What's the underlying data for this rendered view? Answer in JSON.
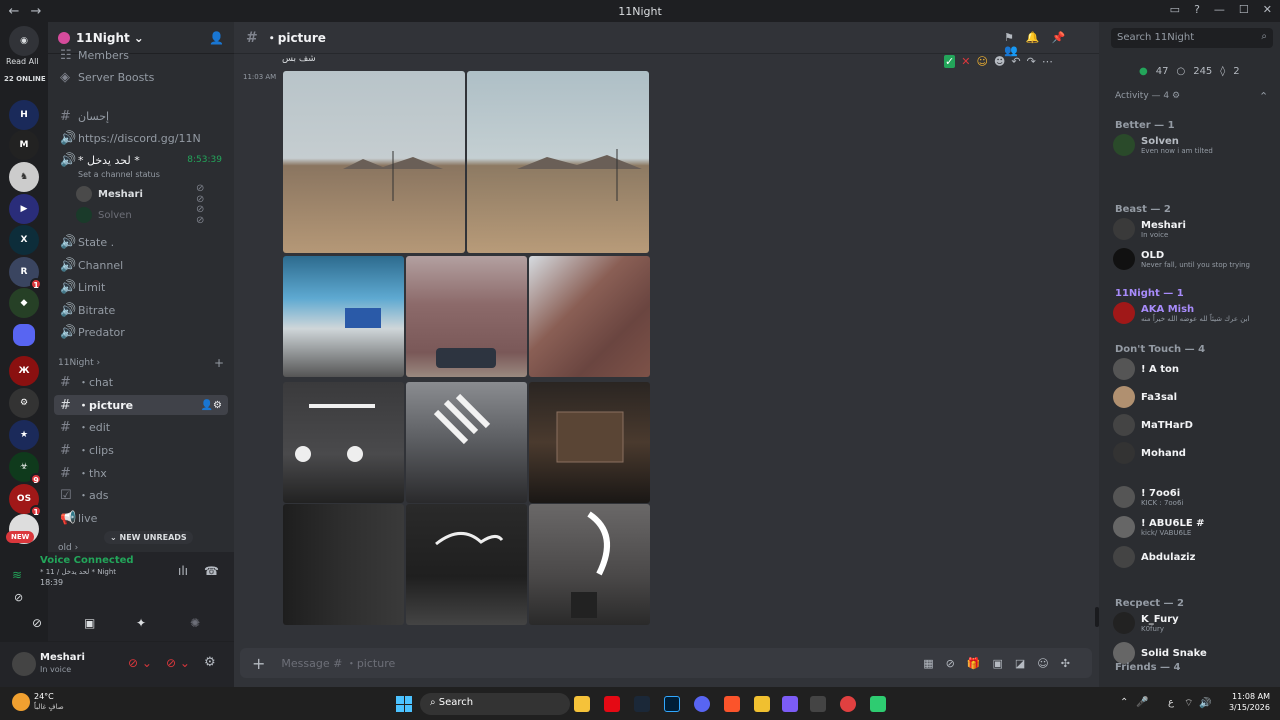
{
  "window": {
    "title": "11Night",
    "back": "←",
    "forward": "→"
  },
  "rail": {
    "read_all": "Read All",
    "online": "22 ONLINE",
    "new_label": "NEW"
  },
  "guild": {
    "name": "11Night"
  },
  "sidebar": {
    "members_partial": "Members",
    "server_boosts": "Server Boosts",
    "channels_top": [
      {
        "icon": "#",
        "name": "إحسان"
      },
      {
        "icon": "🔊",
        "name": "https://discord.gg/11N"
      }
    ],
    "voice_channel": {
      "name": "* لحد يدخل *",
      "timer": "8:53:39",
      "status": "Set a channel status",
      "users": [
        {
          "name": "Meshari"
        },
        {
          "name": "Solven"
        }
      ]
    },
    "voice_channels": [
      {
        "name": "State ."
      },
      {
        "name": "Channel"
      },
      {
        "name": "Limit"
      },
      {
        "name": "Bitrate"
      },
      {
        "name": "Predator"
      }
    ],
    "category": "11Night",
    "text_channels": [
      {
        "name": "・chat"
      },
      {
        "name": "・picture"
      },
      {
        "name": "・edit"
      },
      {
        "name": "・clips"
      },
      {
        "name": "・thx"
      },
      {
        "name": "・ads"
      },
      {
        "name": "live"
      }
    ],
    "category2": "old",
    "new_unreads": "NEW UNREADS"
  },
  "voice_panel": {
    "status": "Voice Connected",
    "channel": "* 11 / لحد يدخل * Night",
    "time": "18:39"
  },
  "user_panel": {
    "name": "Meshari",
    "status": "In voice"
  },
  "chat": {
    "channel": "・picture",
    "message_top": "شف بس",
    "timestamp": "11:03 AM",
    "composer_placeholder": "Message # ・picture"
  },
  "members": {
    "search_placeholder": "Search 11Night",
    "counts": {
      "online": "47",
      "offline": "245",
      "boost": "2"
    },
    "activity": "Activity — 4",
    "groups": [
      {
        "label": "Better — 1",
        "color": "#949ba4",
        "members": [
          {
            "name": "Solven",
            "sub": "Even now i am tilted",
            "color": "#b5bac1"
          }
        ]
      },
      {
        "label": "Beast — 2",
        "color": "#949ba4",
        "members": [
          {
            "name": "Meshari",
            "sub": "In voice",
            "color": "#f2f3f5"
          },
          {
            "name": "OLD",
            "sub": "Never fall, until you stop trying",
            "color": "#f2f3f5"
          }
        ]
      },
      {
        "label": "11Night — 1",
        "color": "#a78bfa",
        "members": [
          {
            "name": "AKA Mish",
            "sub": "ابن عرك شيئاً لله عوضه الله خيراً منه",
            "color": "#a78bfa"
          }
        ]
      },
      {
        "label": "Don't Touch — 4",
        "color": "#949ba4",
        "members": [
          {
            "name": "! A ton",
            "sub": "",
            "color": "#f2f3f5"
          },
          {
            "name": "Fa3sal",
            "sub": "",
            "color": "#f2f3f5"
          },
          {
            "name": "MaTHarD",
            "sub": "",
            "color": "#f2f3f5"
          },
          {
            "name": "Mohand",
            "sub": "",
            "color": "#f2f3f5"
          }
        ]
      },
      {
        "label": "",
        "color": "#949ba4",
        "members": [
          {
            "name": "! 7oo6i",
            "sub": "KICK : 7oo6i",
            "color": "#f2f3f5"
          },
          {
            "name": "! ABU6LE #",
            "sub": "kick/ VABU6LE",
            "color": "#f2f3f5"
          },
          {
            "name": "Abdulaziz",
            "sub": "",
            "color": "#f2f3f5"
          }
        ]
      },
      {
        "label": "Recpect — 2",
        "color": "#949ba4",
        "members": [
          {
            "name": "K_Fury",
            "sub": "K0fury",
            "color": "#f2f3f5"
          },
          {
            "name": "Solid Snake",
            "sub": "",
            "color": "#f2f3f5"
          }
        ]
      }
    ],
    "friends": "Friends — 4"
  },
  "taskbar": {
    "weather_temp": "24°C",
    "weather_desc": "صافٍ غالباً",
    "search": "Search",
    "time": "11:08 AM",
    "date": "3/15/2026",
    "lang": "ع"
  }
}
